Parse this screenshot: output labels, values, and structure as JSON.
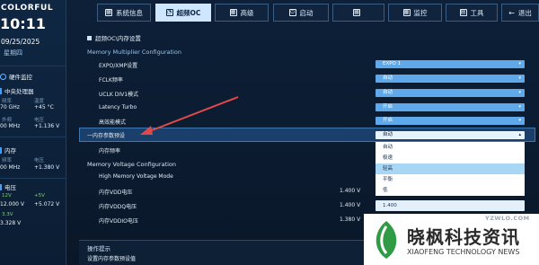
{
  "sidebar": {
    "brand": "COLORFUL",
    "time": "10:11",
    "date": "09/25/2025",
    "weekday": "星期四",
    "hw_title": "硬件监控",
    "cpu": {
      "title": "中央处理器",
      "freq_label": "频率",
      "freq_value": "70 GHz",
      "temp_label": "温度",
      "temp_value": "+45 °C",
      "bclk_label": "外频",
      "bclk_value": "00 MHz",
      "volt_label": "电压",
      "volt_value": "+1.136 V"
    },
    "mem": {
      "title": "内存",
      "freq_label": "频率",
      "freq_value": "00 MHz",
      "volt_label": "电压",
      "volt_value": "+1.380 V"
    },
    "volt": {
      "title": "电压",
      "v12_label": "12V",
      "v12_value": "12.000 V",
      "v5_label": "+5V",
      "v5_value": "+5.072 V",
      "v33_label": "3.3V",
      "v33_value": "3.328 V"
    }
  },
  "tabs": [
    {
      "label": "系统信息",
      "icon": "grid-icon"
    },
    {
      "label": "超频OC",
      "icon": "speedometer-icon"
    },
    {
      "label": "高级",
      "icon": "grid-icon"
    },
    {
      "label": "启动",
      "icon": "power-icon"
    },
    {
      "label": "",
      "icon": "grid-icon"
    },
    {
      "label": "监控",
      "icon": "monitor-icon"
    },
    {
      "label": "工具",
      "icon": "toolbox-icon"
    },
    {
      "label": "退出",
      "icon": "arrow-left-icon"
    }
  ],
  "main": {
    "breadcrumb": "超频OC\\内存设置",
    "section1": "Memory Multiplier Configuration",
    "rows": [
      {
        "label": "EXPO/XMP设置",
        "value": "EXPO 1"
      },
      {
        "label": "FCLK频率",
        "value": "自动"
      },
      {
        "label": "UCLK DIV1模式",
        "value": "自动"
      },
      {
        "label": "Latency Turbo",
        "value": "开启"
      },
      {
        "label": "高效能模式",
        "value": "开启"
      }
    ],
    "highlight_label": "一内存参数预设",
    "highlight_value": "自动",
    "freq_label": "内存频率",
    "options": [
      "自动",
      "极速",
      "轻高",
      "平衡",
      "低"
    ],
    "selected_option": 2,
    "section2": "Memory Voltage Configuration",
    "volt_rows": [
      {
        "label": "High Memory Voltage Mode",
        "value": ""
      },
      {
        "label": "内存VDD电压",
        "value": "1.400 V"
      },
      {
        "label": "内存VDDQ电压",
        "value": "1.400 V"
      },
      {
        "label": "内存VDDIO电压",
        "value": "1.380 V"
      }
    ],
    "field_value": "1.400",
    "footer_title": "操作提示",
    "footer_text": "设置内存参数预设值"
  },
  "watermark": {
    "url": "YZWLO.COM",
    "cn": "晓枫科技资讯",
    "en": "XIAOFENG TECHNOLOGY NEWS"
  },
  "colors": {
    "accent": "#5fa8ea",
    "active_tab": "#cfe6ff",
    "highlight": "#1a3f6a",
    "arrow": "#e0494b"
  }
}
